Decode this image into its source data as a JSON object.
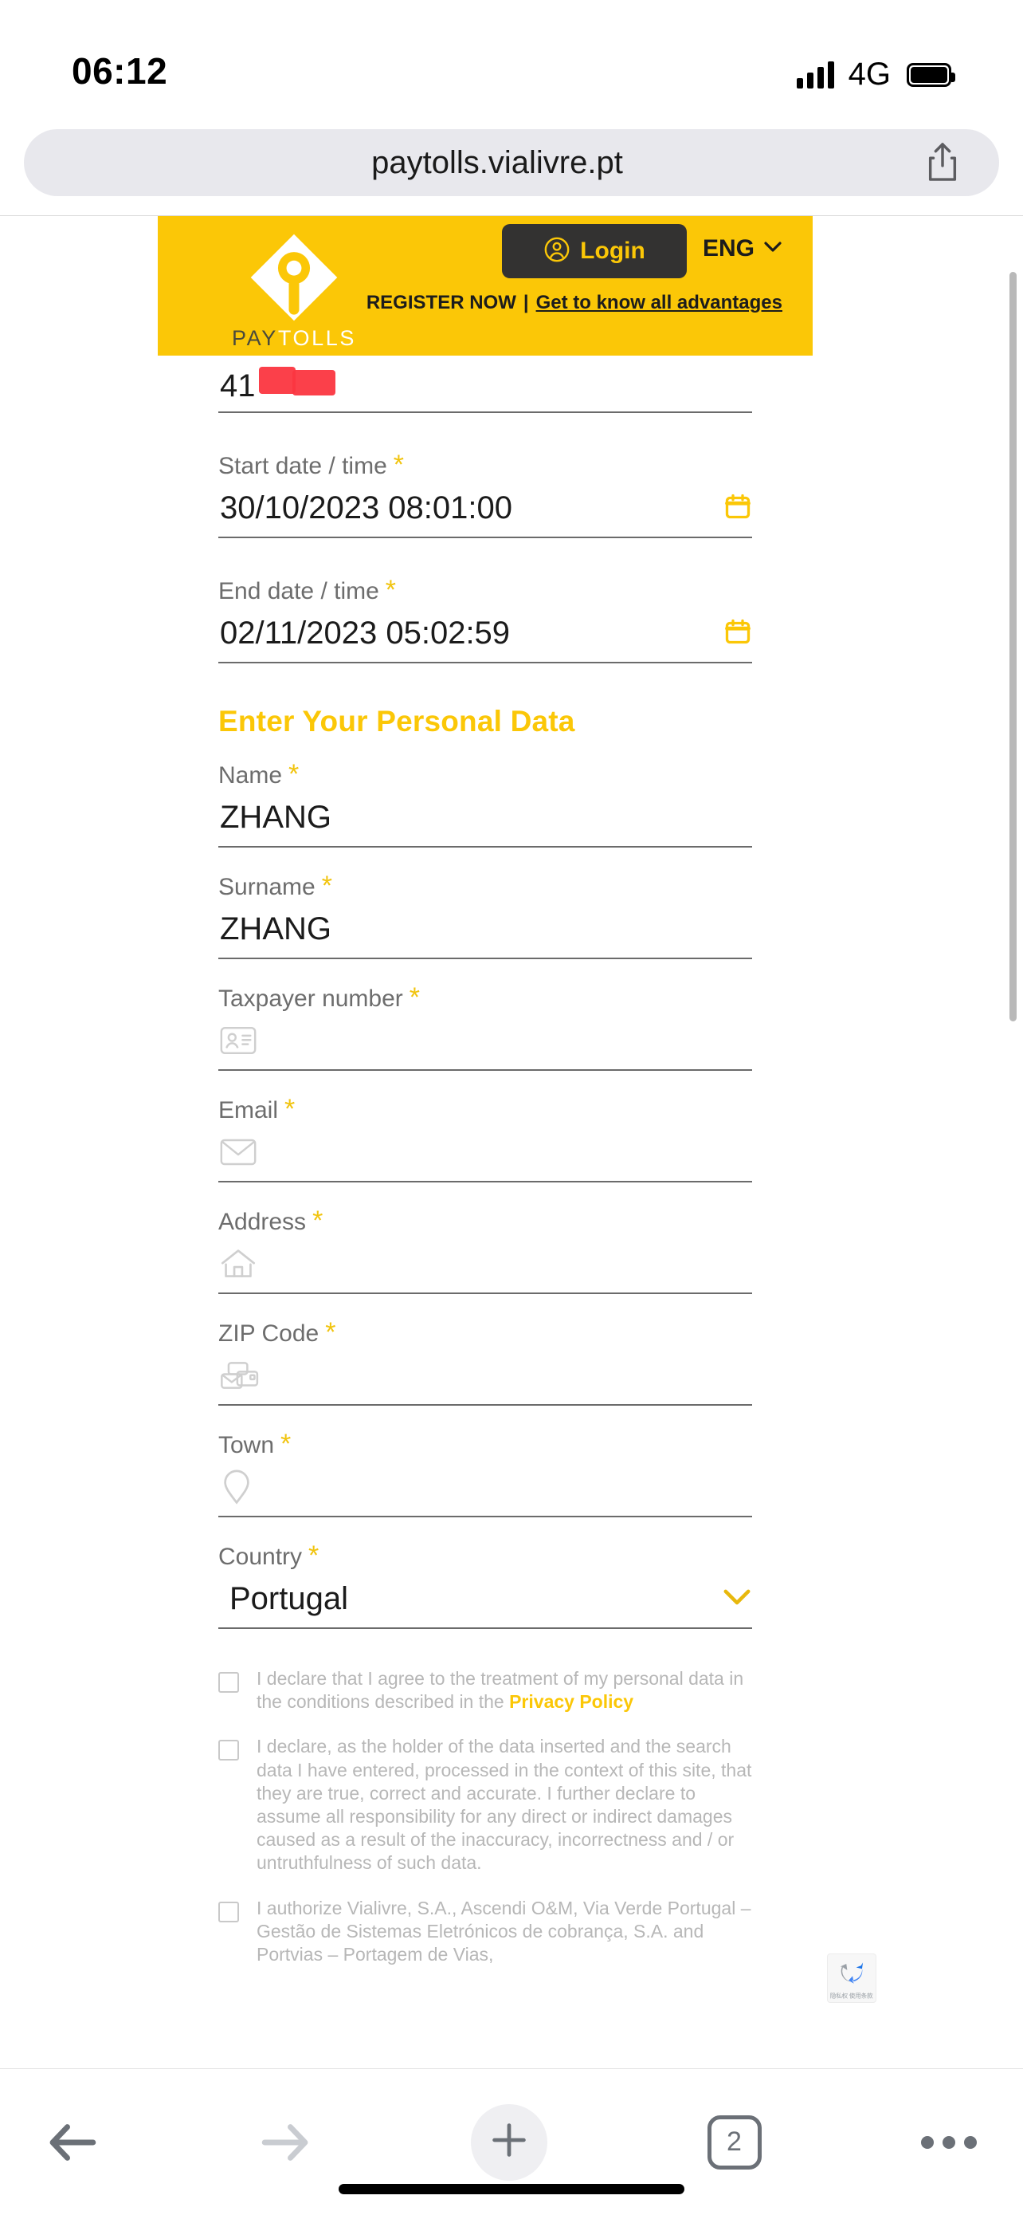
{
  "status_bar": {
    "time": "06:12",
    "network": "4G",
    "signal_icon": "signal-bars-icon",
    "battery_icon": "battery-full-icon"
  },
  "browser": {
    "url": "paytolls.vialivre.pt",
    "share_icon": "share-icon",
    "toolbar": {
      "back_icon": "back-arrow-icon",
      "forward_icon": "forward-arrow-icon",
      "new_tab_icon": "plus-icon",
      "tabs_count": "2",
      "more_icon": "more-ellipsis-icon"
    }
  },
  "site_header": {
    "logo_pay": "PAY",
    "logo_tolls": "TOLLS",
    "logo_icon": "paytolls-pin-logo-icon",
    "login_label": "Login",
    "login_icon": "user-circle-icon",
    "language": "ENG",
    "language_chevron_icon": "chevron-down-icon",
    "register_label": "REGISTER NOW",
    "register_separator": "|",
    "advantages_label": "Get to know all advantages",
    "colors": {
      "brand_yellow": "#fbc707",
      "dark": "#333231"
    }
  },
  "form": {
    "plate": {
      "value_visible": "41",
      "redacted": true
    },
    "start_date": {
      "label": "Start date / time",
      "required_mark": "*",
      "value": "30/10/2023 08:01:00",
      "icon": "calendar-icon"
    },
    "end_date": {
      "label": "End date / time",
      "required_mark": "*",
      "value": "02/11/2023 05:02:59",
      "icon": "calendar-icon"
    },
    "personal_section_title": "Enter Your Personal Data",
    "fields": [
      {
        "label": "Name",
        "required_mark": "*",
        "value": "ZHANG",
        "placeholder_icon": null
      },
      {
        "label": "Surname",
        "required_mark": "*",
        "value": "ZHANG",
        "placeholder_icon": null
      },
      {
        "label": "Taxpayer number",
        "required_mark": "*",
        "value": "",
        "placeholder_icon": "id-card-icon"
      },
      {
        "label": "Email",
        "required_mark": "*",
        "value": "",
        "placeholder_icon": "envelope-icon"
      },
      {
        "label": "Address",
        "required_mark": "*",
        "value": "",
        "placeholder_icon": "house-icon"
      },
      {
        "label": "ZIP Code",
        "required_mark": "*",
        "value": "",
        "placeholder_icon": "mail-card-icon"
      },
      {
        "label": "Town",
        "required_mark": "*",
        "value": "",
        "placeholder_icon": "map-pin-icon"
      }
    ],
    "country": {
      "label": "Country",
      "required_mark": "*",
      "value": "Portugal",
      "chevron_icon": "chevron-down-icon"
    },
    "consents": [
      {
        "text_before": "I declare that I agree to the treatment of my personal data in the conditions described in the ",
        "link": "Privacy Policy",
        "text_after": "",
        "checked": false
      },
      {
        "text_before": "I declare, as the holder of the data inserted and the search data I have entered, processed in the context of this site, that they are true, correct and accurate. I further declare to assume all responsibility for any direct or indirect damages caused as a result of the inaccuracy, incorrectness and / or untruthfulness of such data.",
        "link": "",
        "text_after": "",
        "checked": false
      },
      {
        "text_before": "I authorize Vialivre, S.A., Ascendi O&M, Via Verde Portugal – Gestão de Sistemas Eletrónicos de cobrança, S.A. and Portvias – Portagem de Vias,",
        "link": "",
        "text_after": "",
        "checked": false
      }
    ],
    "recaptcha": {
      "icon": "recaptcha-icon",
      "privacy_label": "隐私权",
      "terms_label": "使用条款"
    }
  }
}
